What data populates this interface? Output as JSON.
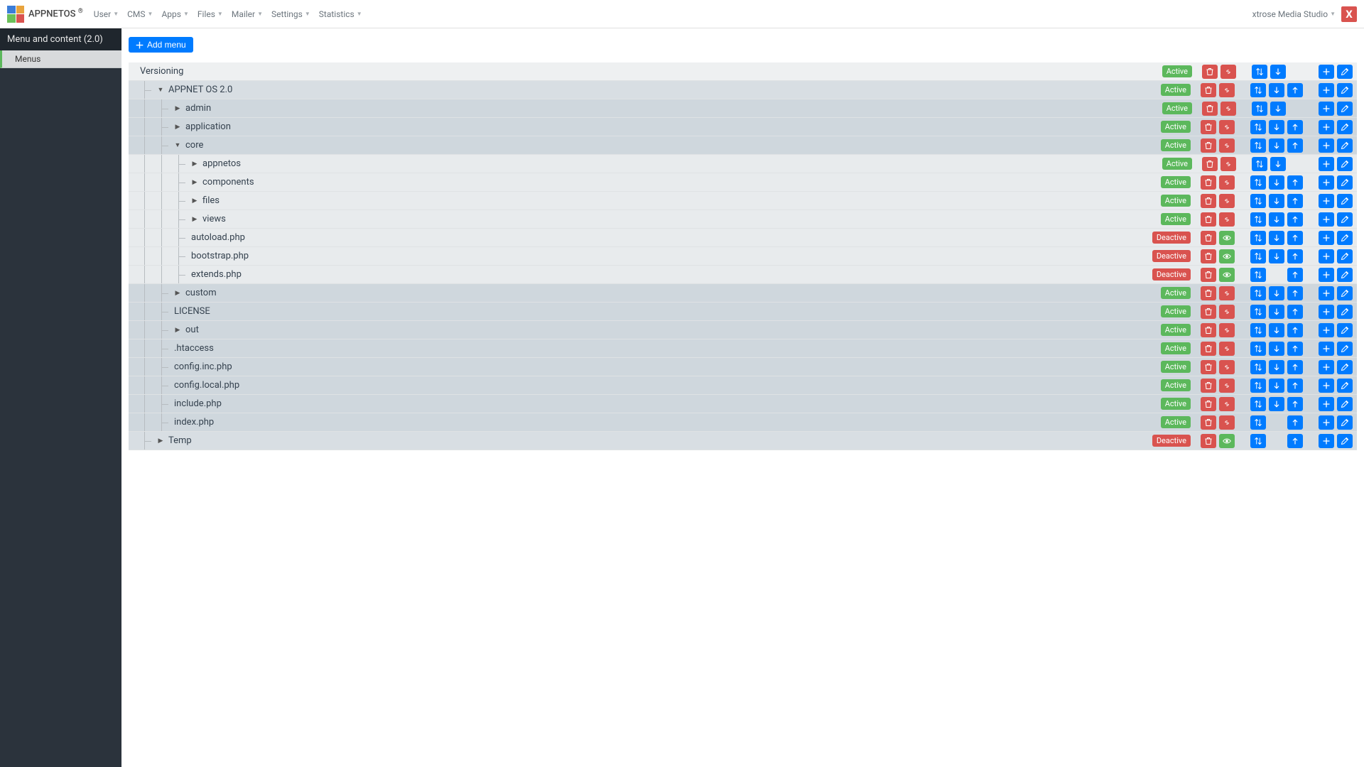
{
  "header": {
    "brand": "APPNETOS",
    "brand_sup": "®",
    "menus": [
      "User",
      "CMS",
      "Apps",
      "Files",
      "Mailer",
      "Settings",
      "Statistics"
    ],
    "user_label": "xtrose Media Studio",
    "brand_x": "X"
  },
  "sidebar": {
    "title": "Menu and content (2.0)",
    "items": [
      "Menus"
    ]
  },
  "toolbar": {
    "add_menu": "Add menu"
  },
  "status": {
    "active": "Active",
    "deactive": "Deactive"
  },
  "icons": {
    "trash": "trash",
    "link": "link",
    "sort": "sort",
    "down": "down",
    "up": "up",
    "plus": "plus",
    "edit": "edit",
    "eye": "eye"
  },
  "tree": [
    {
      "label": "Versioning",
      "status": "active",
      "depth": 0,
      "caret": "",
      "btns": [
        "trash",
        "link",
        "|",
        "sort",
        "down",
        "||",
        "plus",
        "edit"
      ]
    },
    {
      "label": "APPNET OS 2.0",
      "status": "active",
      "depth": 1,
      "caret": "down",
      "btns": [
        "trash",
        "link",
        "|",
        "sort",
        "down",
        "up",
        "|",
        "plus",
        "edit"
      ]
    },
    {
      "label": "admin",
      "status": "active",
      "depth": 2,
      "caret": "right",
      "btns": [
        "trash",
        "link",
        "|",
        "sort",
        "down",
        "||",
        "plus",
        "edit"
      ]
    },
    {
      "label": "application",
      "status": "active",
      "depth": 2,
      "caret": "right",
      "btns": [
        "trash",
        "link",
        "|",
        "sort",
        "down",
        "up",
        "|",
        "plus",
        "edit"
      ]
    },
    {
      "label": "core",
      "status": "active",
      "depth": 2,
      "caret": "down",
      "btns": [
        "trash",
        "link",
        "|",
        "sort",
        "down",
        "up",
        "|",
        "plus",
        "edit"
      ]
    },
    {
      "label": "appnetos",
      "status": "active",
      "depth": 3,
      "caret": "right",
      "btns": [
        "trash",
        "link",
        "|",
        "sort",
        "down",
        "||",
        "plus",
        "edit"
      ]
    },
    {
      "label": "components",
      "status": "active",
      "depth": 3,
      "caret": "right",
      "btns": [
        "trash",
        "link",
        "|",
        "sort",
        "down",
        "up",
        "|",
        "plus",
        "edit"
      ]
    },
    {
      "label": "files",
      "status": "active",
      "depth": 3,
      "caret": "right",
      "btns": [
        "trash",
        "link",
        "|",
        "sort",
        "down",
        "up",
        "|",
        "plus",
        "edit"
      ]
    },
    {
      "label": "views",
      "status": "active",
      "depth": 3,
      "caret": "right",
      "btns": [
        "trash",
        "link",
        "|",
        "sort",
        "down",
        "up",
        "|",
        "plus",
        "edit"
      ]
    },
    {
      "label": "autoload.php",
      "status": "deactive",
      "depth": 3,
      "caret": "",
      "btns": [
        "trash",
        "eye",
        "|",
        "sort",
        "down",
        "up",
        "|",
        "plus",
        "edit"
      ]
    },
    {
      "label": "bootstrap.php",
      "status": "deactive",
      "depth": 3,
      "caret": "",
      "btns": [
        "trash",
        "eye",
        "|",
        "sort",
        "down",
        "up",
        "|",
        "plus",
        "edit"
      ]
    },
    {
      "label": "extends.php",
      "status": "deactive",
      "depth": 3,
      "caret": "",
      "btns": [
        "trash",
        "eye",
        "|",
        "sort",
        "_",
        "up",
        "|",
        "plus",
        "edit"
      ]
    },
    {
      "label": "custom",
      "status": "active",
      "depth": 2,
      "caret": "right",
      "btns": [
        "trash",
        "link",
        "|",
        "sort",
        "down",
        "up",
        "|",
        "plus",
        "edit"
      ]
    },
    {
      "label": "LICENSE",
      "status": "active",
      "depth": 2,
      "caret": "",
      "btns": [
        "trash",
        "link",
        "|",
        "sort",
        "down",
        "up",
        "|",
        "plus",
        "edit"
      ]
    },
    {
      "label": "out",
      "status": "active",
      "depth": 2,
      "caret": "right",
      "btns": [
        "trash",
        "link",
        "|",
        "sort",
        "down",
        "up",
        "|",
        "plus",
        "edit"
      ]
    },
    {
      "label": ".htaccess",
      "status": "active",
      "depth": 2,
      "caret": "",
      "btns": [
        "trash",
        "link",
        "|",
        "sort",
        "down",
        "up",
        "|",
        "plus",
        "edit"
      ]
    },
    {
      "label": "config.inc.php",
      "status": "active",
      "depth": 2,
      "caret": "",
      "btns": [
        "trash",
        "link",
        "|",
        "sort",
        "down",
        "up",
        "|",
        "plus",
        "edit"
      ]
    },
    {
      "label": "config.local.php",
      "status": "active",
      "depth": 2,
      "caret": "",
      "btns": [
        "trash",
        "link",
        "|",
        "sort",
        "down",
        "up",
        "|",
        "plus",
        "edit"
      ]
    },
    {
      "label": "include.php",
      "status": "active",
      "depth": 2,
      "caret": "",
      "btns": [
        "trash",
        "link",
        "|",
        "sort",
        "down",
        "up",
        "|",
        "plus",
        "edit"
      ]
    },
    {
      "label": "index.php",
      "status": "active",
      "depth": 2,
      "caret": "",
      "btns": [
        "trash",
        "link",
        "|",
        "sort",
        "_",
        "up",
        "|",
        "plus",
        "edit"
      ]
    },
    {
      "label": "Temp",
      "status": "deactive",
      "depth": 1,
      "caret": "right",
      "btns": [
        "trash",
        "eye",
        "|",
        "sort",
        "_",
        "up",
        "|",
        "plus",
        "edit"
      ]
    }
  ]
}
